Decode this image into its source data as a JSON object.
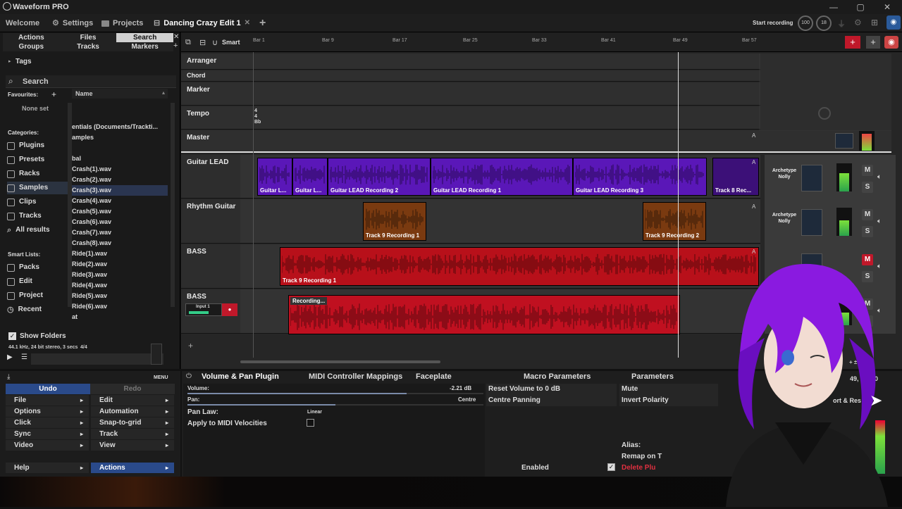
{
  "app": {
    "title": "Waveform PRO"
  },
  "tabs": [
    {
      "label": "Welcome"
    },
    {
      "label": "Settings"
    },
    {
      "label": "Projects"
    },
    {
      "label": "Dancing Crazy Edit 1"
    }
  ],
  "top_right": {
    "start_recording": "Start recording",
    "tempo_value": "100",
    "counter_value": "18"
  },
  "browser": {
    "tabs_row1": [
      "Actions",
      "Files",
      "Search"
    ],
    "tabs_row2": [
      "Groups",
      "Tracks",
      "Markers"
    ],
    "tags_label": "Tags",
    "search_placeholder": "Search",
    "favourites_label": "Favourites:",
    "none_set": "None set",
    "name_header": "Name",
    "categories_label": "Categories:",
    "categories": [
      "Plugins",
      "Presets",
      "Racks",
      "Samples",
      "Clips",
      "Tracks",
      "All results"
    ],
    "smart_lists_label": "Smart Lists:",
    "smart_lists": [
      "Packs",
      "Edit",
      "Project",
      "Recent"
    ],
    "files": [
      "entials (Documents/Trackti...",
      "amples",
      "",
      "bal",
      "Crash(1).wav",
      "Crash(2).wav",
      "Crash(3).wav",
      "Crash(4).wav",
      "Crash(5).wav",
      "Crash(6).wav",
      "Crash(7).wav",
      "Crash(8).wav",
      "Ride(1).wav",
      "Ride(2).wav",
      "Ride(3).wav",
      "Ride(4).wav",
      "Ride(5).wav",
      "Ride(6).wav",
      "at"
    ],
    "show_folders": "Show Folders",
    "file_info": "44.1 kHz, 24 bit stereo, 3 secs",
    "file_info_count": "4/4"
  },
  "toolbar": {
    "smart_label": "Smart"
  },
  "ruler": {
    "bars": [
      "Bar 1",
      "Bar 9",
      "Bar 17",
      "Bar 25",
      "Bar 33",
      "Bar 41",
      "Bar 49",
      "Bar 57"
    ]
  },
  "global_tracks": [
    {
      "name": "Arranger"
    },
    {
      "name": "Chord"
    },
    {
      "name": "Marker"
    },
    {
      "name": "Tempo"
    },
    {
      "name": "Master"
    }
  ],
  "tempo_marker": {
    "line1": "4",
    "line2": "4",
    "line3": "Bb"
  },
  "tracks": [
    {
      "name": "Guitar LEAD",
      "clips": [
        "Guitar L...",
        "Guitar L...",
        "Guitar LEAD Recording 2",
        "Guitar LEAD Recording 1",
        "Guitar LEAD Recording 3",
        "Track 8 Rec..."
      ],
      "plugin": "Archetype Nolly"
    },
    {
      "name": "Rhythm Guitar",
      "clips": [
        "Track 9 Recording 1",
        "Track 9 Recording 2"
      ],
      "plugin": "Archetype Nolly"
    },
    {
      "name": "BASS",
      "clips": [
        "Track 9 Recording 1"
      ]
    },
    {
      "name": "BASS",
      "clips": [
        "Recording..."
      ],
      "input": "Input 1"
    }
  ],
  "mixer_buttons": {
    "mute": "M",
    "solo": "S",
    "auto": "A"
  },
  "menu": {
    "menu_label": "MENU",
    "undo": "Undo",
    "redo": "Redo",
    "left": [
      "File",
      "Options",
      "Click",
      "Sync",
      "Video"
    ],
    "right": [
      "Edit",
      "Automation",
      "Snap-to-grid",
      "Track",
      "View"
    ],
    "help": "Help",
    "actions": "Actions"
  },
  "plugin_panel": {
    "tabs": [
      "Volume & Pan Plugin",
      "MIDI Controller Mappings",
      "Faceplate",
      "Macro Parameters",
      "Parameters"
    ],
    "volume_label": "Volume:",
    "volume_value": "-2.21 dB",
    "pan_label": "Pan:",
    "pan_value": "Centre",
    "pan_law_label": "Pan Law:",
    "pan_law_value": "Linear",
    "apply_midi": "Apply to MIDI Velocities",
    "reset_volume": "Reset Volume to 0 dB",
    "centre_panning": "Centre Panning",
    "mute": "Mute",
    "invert_polarity": "Invert Polarity",
    "alias": "Alias:",
    "remap": "Remap on T",
    "enabled": "Enabled",
    "delete_plugin": "Delete Plu",
    "position": "49, 3, 700",
    "export_reset": "ort & Res"
  },
  "colors": {
    "accent": "#d01a2a",
    "purple": "#5a17b8",
    "orange": "#7a3a10",
    "red": "#b8101a",
    "selection": "#2a3550"
  }
}
